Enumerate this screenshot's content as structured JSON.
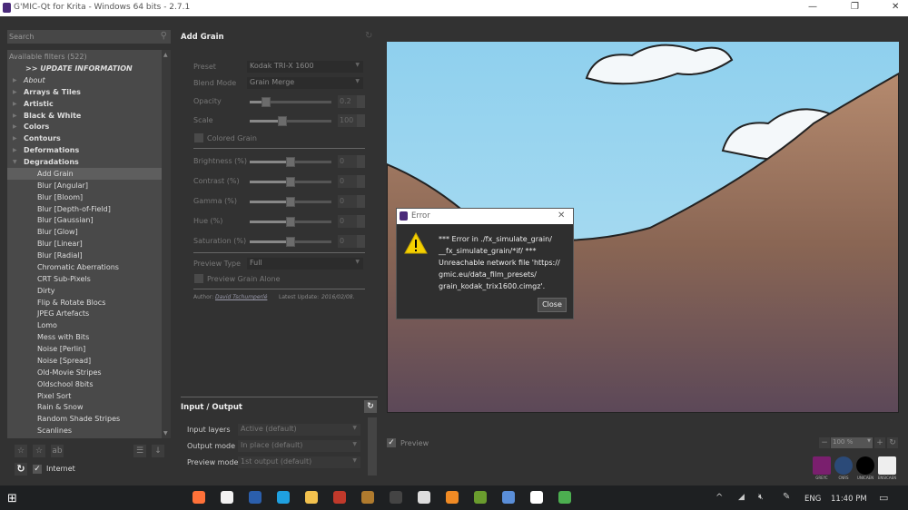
{
  "window": {
    "title": "G'MIC-Qt for Krita - Windows 64 bits - 2.7.1"
  },
  "search": {
    "placeholder": "Search"
  },
  "filters": {
    "header": "Available filters (522)",
    "items": [
      {
        "label": ">> UPDATE INFORMATION",
        "style": "bi"
      },
      {
        "label": "About",
        "style": "i",
        "arrow": true
      },
      {
        "label": "Arrays & Tiles",
        "style": "b",
        "arrow": true
      },
      {
        "label": "Artistic",
        "style": "b",
        "arrow": true
      },
      {
        "label": "Black & White",
        "style": "b",
        "arrow": true
      },
      {
        "label": "Colors",
        "style": "b",
        "arrow": true
      },
      {
        "label": "Contours",
        "style": "b",
        "arrow": true
      },
      {
        "label": "Deformations",
        "style": "b",
        "arrow": true
      },
      {
        "label": "Degradations",
        "style": "b",
        "arrow": true,
        "open": true
      },
      {
        "label": "Add Grain",
        "sub": true,
        "selected": true
      },
      {
        "label": "Blur [Angular]",
        "sub": true
      },
      {
        "label": "Blur [Bloom]",
        "sub": true
      },
      {
        "label": "Blur [Depth-of-Field]",
        "sub": true
      },
      {
        "label": "Blur [Gaussian]",
        "sub": true
      },
      {
        "label": "Blur [Glow]",
        "sub": true
      },
      {
        "label": "Blur [Linear]",
        "sub": true
      },
      {
        "label": "Blur [Radial]",
        "sub": true
      },
      {
        "label": "Chromatic Aberrations",
        "sub": true
      },
      {
        "label": "CRT Sub-Pixels",
        "sub": true
      },
      {
        "label": "Dirty",
        "sub": true
      },
      {
        "label": "Flip & Rotate Blocs",
        "sub": true
      },
      {
        "label": "JPEG Artefacts",
        "sub": true
      },
      {
        "label": "Lomo",
        "sub": true
      },
      {
        "label": "Mess with Bits",
        "sub": true
      },
      {
        "label": "Noise [Perlin]",
        "sub": true
      },
      {
        "label": "Noise [Spread]",
        "sub": true
      },
      {
        "label": "Old-Movie Stripes",
        "sub": true
      },
      {
        "label": "Oldschool 8bits",
        "sub": true
      },
      {
        "label": "Pixel Sort",
        "sub": true
      },
      {
        "label": "Rain & Snow",
        "sub": true
      },
      {
        "label": "Random Shade Stripes",
        "sub": true
      },
      {
        "label": "Scanlines",
        "sub": true
      }
    ],
    "internet_label": "Internet"
  },
  "filter": {
    "title": "Add Grain",
    "preset": {
      "label": "Preset",
      "value": "Kodak TRI-X 1600"
    },
    "blend": {
      "label": "Blend Mode",
      "value": "Grain Merge"
    },
    "opacity": {
      "label": "Opacity",
      "value": "0.2",
      "fraction": 0.2
    },
    "scale": {
      "label": "Scale",
      "value": "100",
      "fraction": 0.4
    },
    "colored_grain": {
      "label": "Colored Grain",
      "checked": false
    },
    "brightness": {
      "label": "Brightness (%)",
      "value": "0",
      "fraction": 0.5
    },
    "contrast": {
      "label": "Contrast (%)",
      "value": "0",
      "fraction": 0.5
    },
    "gamma": {
      "label": "Gamma (%)",
      "value": "0",
      "fraction": 0.5
    },
    "hue": {
      "label": "Hue (%)",
      "value": "0",
      "fraction": 0.5
    },
    "saturation": {
      "label": "Saturation (%)",
      "value": "0",
      "fraction": 0.5
    },
    "preview_type": {
      "label": "Preview Type",
      "value": "Full"
    },
    "preview_grain_alone": {
      "label": "Preview Grain Alone",
      "checked": false
    },
    "author_label": "Author:",
    "author": "David Tschumperlé",
    "update_label": "Latest Update:",
    "update": "2016/02/08."
  },
  "io": {
    "title": "Input / Output",
    "input_layers": {
      "label": "Input layers",
      "value": "Active (default)"
    },
    "output_mode": {
      "label": "Output mode",
      "value": "In place (default)"
    },
    "preview_mode": {
      "label": "Preview mode",
      "value": "1st output (default)"
    }
  },
  "preview": {
    "label": "Preview",
    "checked": true,
    "zoom": "100 %"
  },
  "logos": [
    "GREYC",
    "CNRS",
    "UNICAEN",
    "ENSICAEN"
  ],
  "error": {
    "title": "Error",
    "message": "*** Error in ./fx_simulate_grain/ __fx_simulate_grain/*if/ *** Unreachable network file 'https:// gmic.eu/data_film_presets/ grain_kodak_trix1600.cimgz'.",
    "lines": [
      "*** Error in ./fx_simulate_grain/",
      "__fx_simulate_grain/*if/ ***",
      "Unreachable network file 'https://",
      "gmic.eu/data_film_presets/",
      "grain_kodak_trix1600.cimgz'."
    ],
    "close": "Close"
  },
  "taskbar": {
    "lang": "ENG",
    "time": "11:40 PM"
  }
}
